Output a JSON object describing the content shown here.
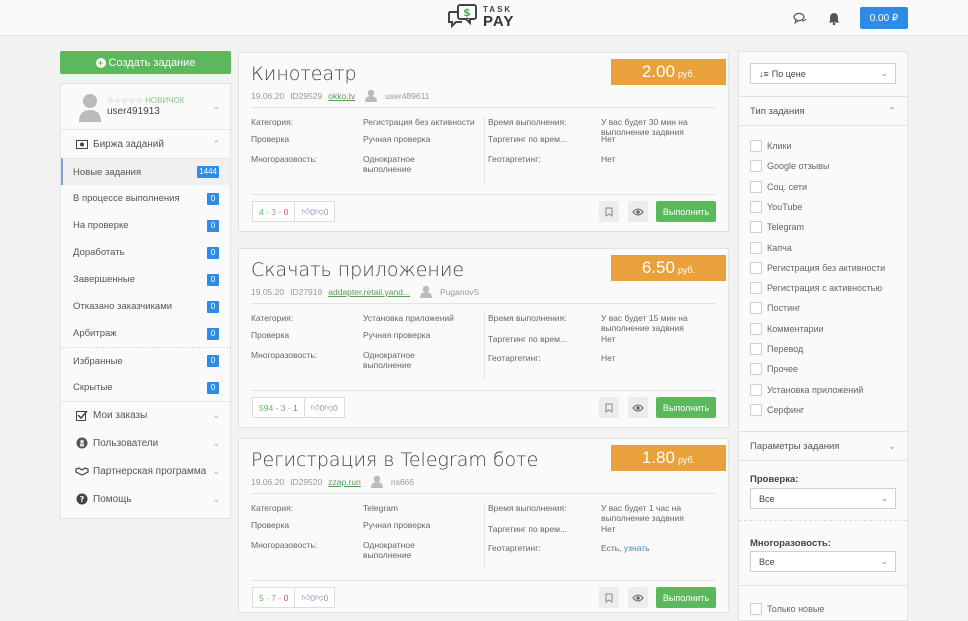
{
  "header": {
    "logo_top": "TASK",
    "logo_bottom": "PAY",
    "balance": "0.00 ₽",
    "icons": [
      "chat-icon",
      "bell-icon"
    ]
  },
  "sidebar": {
    "create_button": "Создать задание",
    "user": {
      "rank": "☆☆☆☆☆ НОВИЧОК",
      "name": "user491913"
    },
    "exchange_section": "Биржа заданий",
    "items": [
      {
        "label": "Новые задания",
        "count": "1444"
      },
      {
        "label": "В процессе выполнения",
        "count": "0"
      },
      {
        "label": "На проверке",
        "count": "0"
      },
      {
        "label": "Доработать",
        "count": "0"
      },
      {
        "label": "Завершенные",
        "count": "0"
      },
      {
        "label": "Отказано заказчиками",
        "count": "0"
      },
      {
        "label": "Арбитраж",
        "count": "0"
      },
      {
        "label": "Избранные",
        "count": "0"
      },
      {
        "label": "Скрытые",
        "count": "0"
      }
    ],
    "sections": [
      {
        "label": "Мои заказы",
        "icon": "checkbox-icon"
      },
      {
        "label": "Пользователи",
        "icon": "users-icon"
      },
      {
        "label": "Партнерская программа",
        "icon": "handshake-icon"
      },
      {
        "label": "Помощь",
        "icon": "help-icon"
      }
    ]
  },
  "labels": {
    "category": "Категория:",
    "check": "Проверка",
    "multi": "Многоразовость:",
    "time": "Время выполнения:",
    "time_target": "Таргетинг по врем...",
    "geo": "Геотаргетинг:",
    "execute": "Выполнить",
    "currency": "руб."
  },
  "tasks": [
    {
      "title": "Кинотеатр",
      "price": "2.00",
      "date": "19.06.20",
      "id": "ID29529",
      "link": "okko.tv",
      "author": "user489611",
      "category": "Регистрация без активности",
      "check": "Ручная проверка",
      "multi": "Однократное выполнение",
      "time": "У вас будет 30 мин на выполнение задвния",
      "time_target": "Нет",
      "geo": "Нет",
      "geo_link": "",
      "stats": {
        "a": "4",
        "b": "3",
        "c": "0",
        "likes": "0",
        "dislikes": "0"
      }
    },
    {
      "title": "Скачать приложение",
      "price": "6.50",
      "date": "19.05.20",
      "id": "ID27919",
      "link": "addapter.retail.yand...",
      "author": "PuganovS",
      "category": "Установка приложений",
      "check": "Ручная проверка",
      "multi": "Однократное выполнение",
      "time": "У вас будет 15 мин на выполнение задвния",
      "time_target": "Нет",
      "geo": "Нет",
      "geo_link": "",
      "stats": {
        "a": "594",
        "b": "3",
        "c": "1",
        "likes": "0",
        "dislikes": "0"
      }
    },
    {
      "title": "Регистрация в Telegram боте",
      "price": "1.80",
      "date": "19.06.20",
      "id": "ID29520",
      "link": "zzap.run",
      "author": "ns666",
      "category": "Telegram",
      "check": "Ручная проверка",
      "multi": "Однократное выполнение",
      "time": "У вас будет 1 час на выполнение задвния",
      "time_target": "Нет",
      "geo": "Есть,",
      "geo_link": "узнать",
      "stats": {
        "a": "5",
        "b": "7",
        "c": "0",
        "likes": "0",
        "dislikes": "0"
      }
    }
  ],
  "filters": {
    "sort": "По цене",
    "type_header": "Тип задания",
    "types": [
      "Клики",
      "Google отзывы",
      "Соц. сети",
      "YouTube",
      "Telegram",
      "Капча",
      "Регистрация без активности",
      "Регистрация с активностью",
      "Постинг",
      "Комментарии",
      "Перевод",
      "Прочее",
      "Установка приложений",
      "Серфинг"
    ],
    "params_header": "Параметры задания",
    "check_label": "Проверка:",
    "check_value": "Все",
    "multi_label": "Многоразовость:",
    "multi_value": "Все",
    "only_new": "Только новые"
  },
  "colors": {
    "green": "#5cb85c",
    "blue": "#2e8ce6",
    "orange": "#e9a23b"
  }
}
